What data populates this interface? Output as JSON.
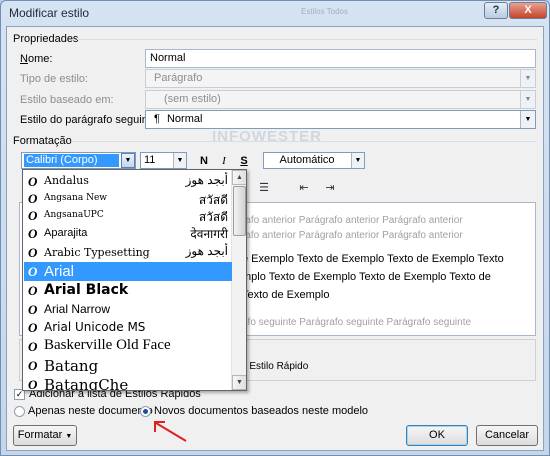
{
  "window": {
    "title": "Modificar estilo",
    "faded_title": "Estilos Todos",
    "help_label": "?",
    "close_label": "X"
  },
  "properties": {
    "section_label": "Propriedades",
    "name_label": "Nome:",
    "name_value": "Normal",
    "style_type_label": "Tipo de estilo:",
    "style_type_value": "Parágrafo",
    "based_on_label": "Estilo baseado em:",
    "based_on_value": "(sem estilo)",
    "next_style_label": "Estilo do parágrafo seguinte:",
    "next_style_icon": "¶",
    "next_style_value": "Normal"
  },
  "formatting": {
    "section_label": "Formatação",
    "watermark": "INFOWESTER",
    "font_value": "Calibri (Corpo)",
    "size_value": "11",
    "bold_label": "N",
    "italic_label": "I",
    "underline_label": "S",
    "color_value": "Automático"
  },
  "font_list": {
    "items": [
      {
        "name": "Andalus",
        "sample": "أبجد هوز",
        "selected": false
      },
      {
        "name": "Angsana New",
        "sample": "สวัสดี",
        "selected": false
      },
      {
        "name": "AngsanaUPC",
        "sample": "สวัสดี",
        "selected": false
      },
      {
        "name": "Aparajita",
        "sample": "देवनागरी",
        "selected": false
      },
      {
        "name": "Arabic Typesetting",
        "sample": "أبجد هوز",
        "selected": false
      },
      {
        "name": "Arial",
        "sample": "",
        "selected": true
      },
      {
        "name": "Arial Black",
        "sample": "",
        "selected": false
      },
      {
        "name": "Arial Narrow",
        "sample": "",
        "selected": false
      },
      {
        "name": "Arial Unicode MS",
        "sample": "",
        "selected": false
      },
      {
        "name": "Baskerville Old Face",
        "sample": "",
        "selected": false
      },
      {
        "name": "Batang",
        "sample": "",
        "selected": false
      },
      {
        "name": "BatangChe",
        "sample": "",
        "selected": false
      }
    ],
    "font_icon": "O"
  },
  "preview": {
    "prev_line1": "rafo anterior Parágrafo anterior Parágrafo anterior",
    "prev_line2": "rafo anterior Parágrafo anterior Parágrafo anterior",
    "main_line1": "e Exemplo Texto de Exemplo Texto de Exemplo Texto",
    "main_line2": "mplo Texto de Exemplo Texto de Exemplo Texto de",
    "main_line3": "Texto de Exemplo",
    "next_line": "afo seguinte Parágrafo seguinte Parágrafo seguinte"
  },
  "description": {
    "text": "tilo: Estilo Rápido"
  },
  "options": {
    "add_quick_styles_label": "Adicionar à lista de Estilos Rápidos",
    "add_quick_styles_checked": true,
    "only_this_doc_label": "Apenas neste documento",
    "new_docs_label": "Novos documentos baseados neste modelo"
  },
  "buttons": {
    "format_label": "Formatar",
    "ok_label": "OK",
    "cancel_label": "Cancelar"
  },
  "colors": {
    "selection": "#3399ff",
    "annotation_arrow": "#e02020"
  }
}
